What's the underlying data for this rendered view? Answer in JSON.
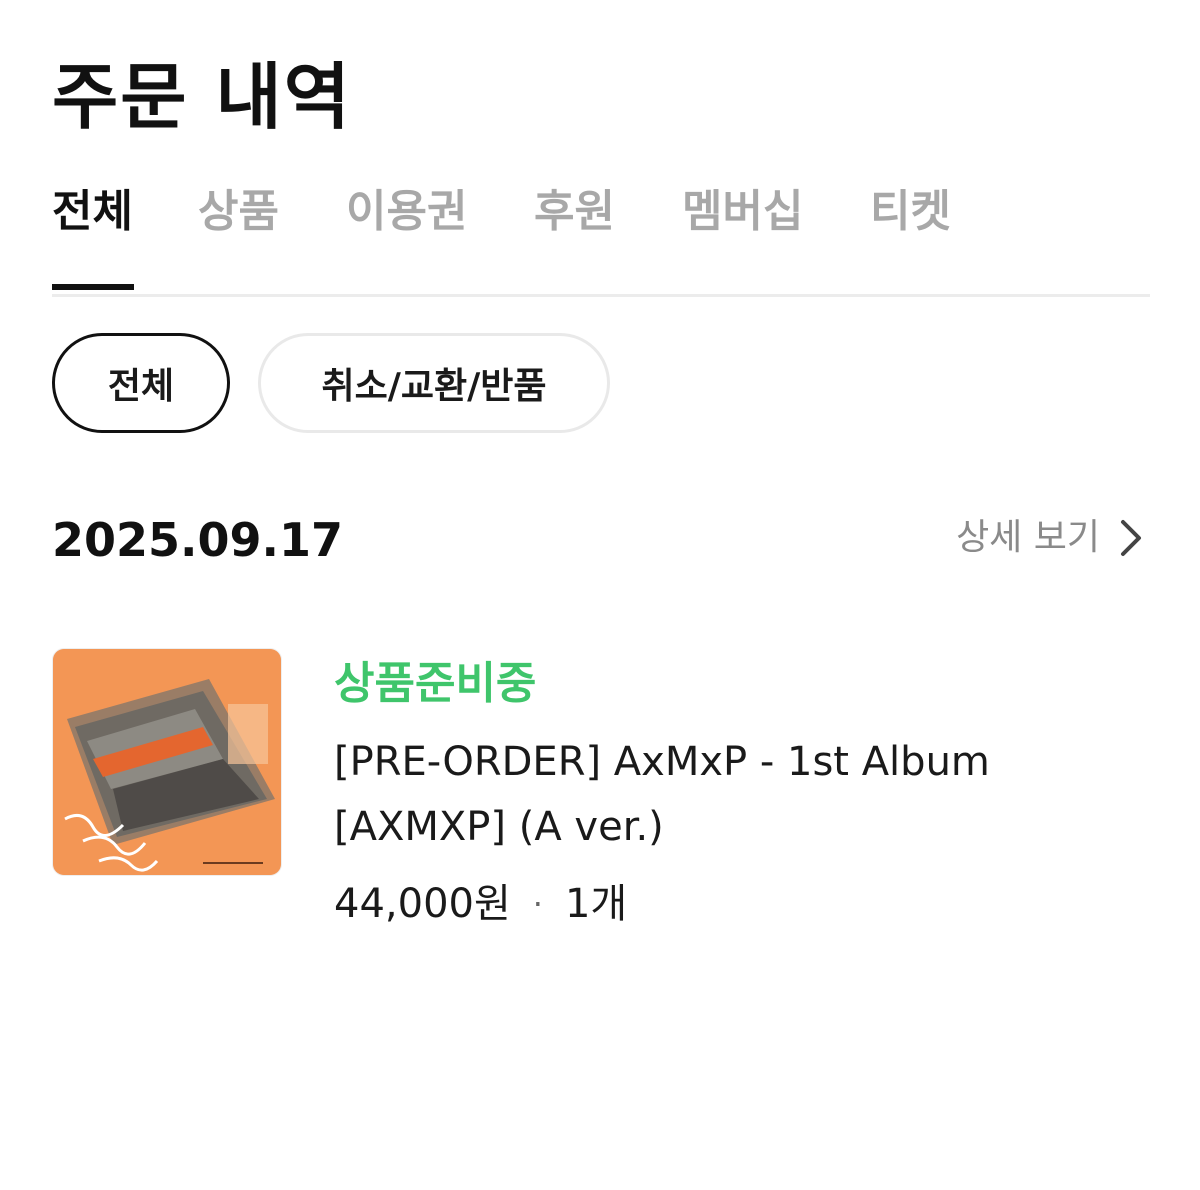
{
  "header": {
    "title": "주문 내역"
  },
  "tabs": [
    {
      "label": "전체",
      "active": true
    },
    {
      "label": "상품",
      "active": false
    },
    {
      "label": "이용권",
      "active": false
    },
    {
      "label": "후원",
      "active": false
    },
    {
      "label": "멤버십",
      "active": false
    },
    {
      "label": "티켓",
      "active": false
    }
  ],
  "filters": [
    {
      "label": "전체",
      "active": true
    },
    {
      "label": "취소/교환/반품",
      "active": false
    }
  ],
  "order": {
    "date": "2025.09.17",
    "detail_label": "상세 보기",
    "detail_icon": "chevron-right-icon",
    "item": {
      "status": "상품준비중",
      "name": "[PRE-ORDER] AxMxP - 1st Album [AXMXP] (A ver.)",
      "price": "44,000원",
      "separator": "·",
      "quantity": "1개"
    }
  },
  "colors": {
    "status_green": "#3fc56b",
    "text_primary": "#111111",
    "tab_inactive": "#a8a8a8",
    "detail_gray": "#8a8a8a"
  }
}
